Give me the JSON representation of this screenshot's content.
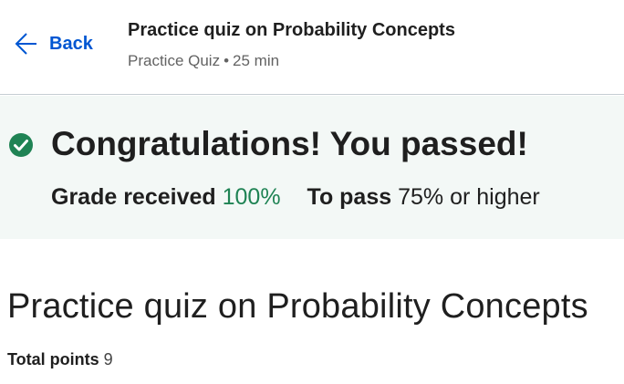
{
  "header": {
    "back_label": "Back",
    "title": "Practice quiz on Probability Concepts",
    "meta_type": "Practice Quiz",
    "meta_separator": "•",
    "meta_duration": "25 min"
  },
  "result": {
    "title": "Congratulations! You passed!",
    "grade_label": "Grade received",
    "grade_value": "100%",
    "pass_label": "To pass",
    "pass_value": "75% or higher",
    "status_icon": "check-circle-icon",
    "status_color": "#1f8354"
  },
  "quiz": {
    "title": "Practice quiz on Probability Concepts",
    "total_points_label": "Total points",
    "total_points_value": "9"
  },
  "colors": {
    "accent": "#0056d2",
    "banner_bg": "#f3f8f6",
    "success": "#1f8354"
  }
}
